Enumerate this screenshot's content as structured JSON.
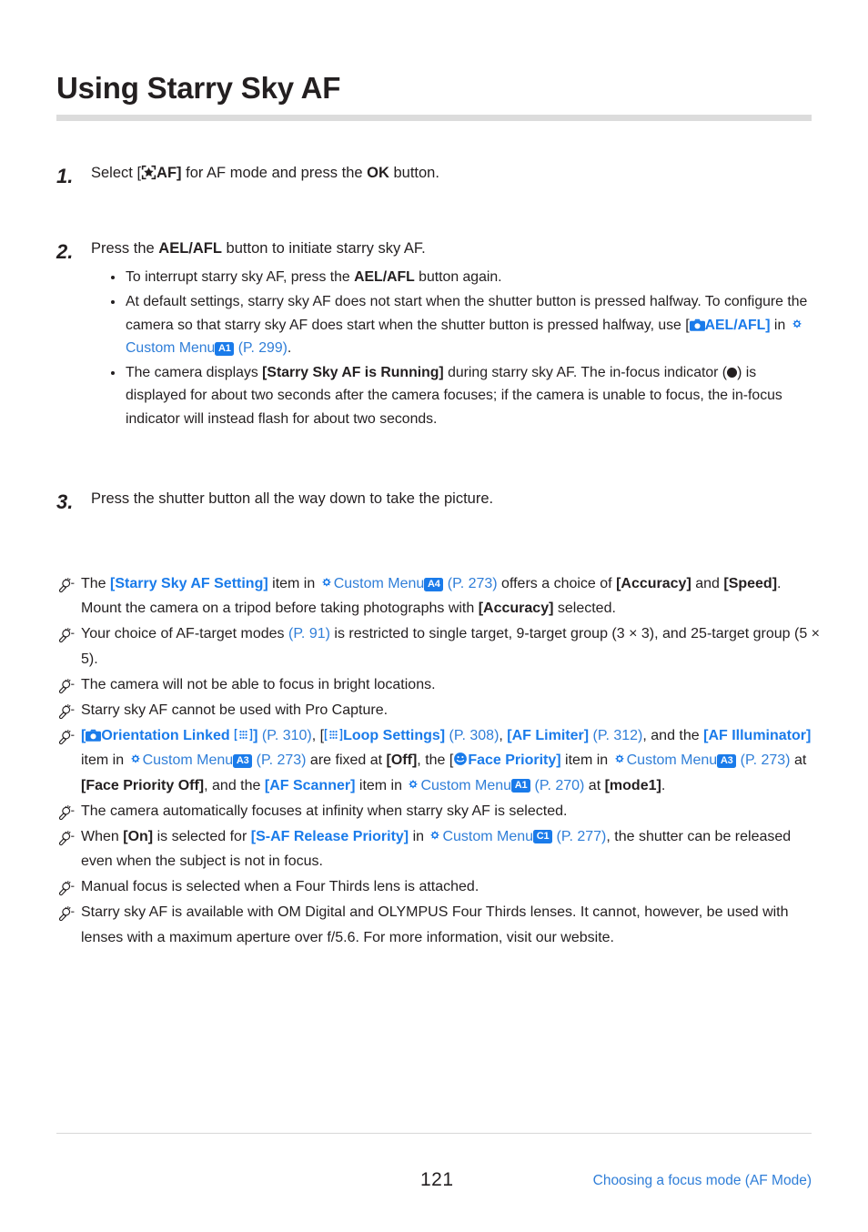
{
  "page": {
    "title": "Using Starry Sky AF",
    "folio": "121",
    "footer_link": "Choosing a focus mode (AF Mode)"
  },
  "colors": {
    "link_blue": "#2f7ed8",
    "bold_link_blue": "#1a7bea",
    "badge_blue": "#1a7bea",
    "text": "#231f20",
    "rule_gray": "#dcdcdc"
  },
  "steps": [
    {
      "number": "1.",
      "text_parts": {
        "p1": "Select [",
        "icon": "starry-sky-af-icon",
        "p2": "AF]",
        "p3": " for AF mode and press the ",
        "bold": "OK",
        "p4": " button."
      }
    },
    {
      "number": "2.",
      "text_parts": {
        "p1": "Press the ",
        "bold": "AEL/AFL",
        "p2": " button to initiate starry sky AF."
      },
      "bullets": [
        {
          "p1": "To interrupt starry sky AF, press the ",
          "bold": "AEL/AFL",
          "p2": " button again."
        },
        {
          "p1": "At default settings, starry sky AF does not start when the shutter button is pressed halfway. To configure the camera so that starry sky AF does start when the shutter button is pressed halfway, use [",
          "icon": "camera-icon",
          "link_bold": "AEL/AFL]",
          "p2": " in ",
          "gear": "gear-icon",
          "link": "Custom Menu",
          "badge": "A1",
          "page_ref": "(P. 299)",
          "p3": "."
        },
        {
          "p1": "The camera displays ",
          "bold": "[Starry Sky AF is Running]",
          "p2": " during starry sky AF. The in-focus indicator (",
          "dot": "in-focus-indicator-dot",
          "p3": ") is displayed for about two seconds after the camera focuses; if the camera is unable to focus, the in-focus indicator will instead flash for about two seconds."
        }
      ]
    },
    {
      "number": "3.",
      "text_parts": {
        "p1": "Press the shutter button all the way down to take the picture."
      }
    }
  ],
  "notes": [
    {
      "id": "note-starry-sky-af-setting",
      "p1": "The ",
      "link_bold": "[Starry Sky AF Setting]",
      "p2": " item in ",
      "gear": "gear-icon",
      "link": "Custom Menu",
      "badge": "A4",
      "page_ref": "(P. 273)",
      "p3": " offers a choice of ",
      "bold1": "[Accuracy]",
      "p4": " and ",
      "bold2": "[Speed]",
      "p5": ". Mount the camera on a tripod before taking photographs with ",
      "bold3": "[Accuracy]",
      "p6": " selected."
    },
    {
      "id": "note-af-target-modes",
      "p1": "Your choice of AF-target modes ",
      "page_ref": "(P. 91)",
      "p2": " is restricted to single target, 9-target group (3 × 3), and 25-target group (5 × 5)."
    },
    {
      "id": "note-bright-locations",
      "p1": "The camera will not be able to focus in bright locations."
    },
    {
      "id": "note-pro-capture",
      "p1": "Starry sky AF cannot be used with Pro Capture."
    },
    {
      "id": "note-fixed-settings",
      "p1": "[",
      "camera_icon": "camera-icon",
      "link_bold1": "Orientation Linked",
      "target_icon1": "af-target-grid-icon",
      "link_bold1_close": "]",
      "page_ref1": "(P. 310)",
      "p2": ", [",
      "target_icon2": "af-target-grid-icon",
      "link_bold2": "Loop Settings]",
      "page_ref2": "(P. 308)",
      "p3": ", ",
      "link_bold3": "[AF Limiter]",
      "page_ref3": "(P. 312)",
      "p4": ", and the ",
      "link_bold4": "[AF Illuminator]",
      "p5": " item in ",
      "gear1": "gear-icon",
      "link1": "Custom Menu",
      "badge1": "A3",
      "page_ref4": "(P. 273)",
      "p6": " are fixed at ",
      "bold1": "[Off]",
      "p7": ", the [",
      "face_icon": "face-priority-icon",
      "link_bold5": "Face Priority]",
      "p8": " item in ",
      "gear2": "gear-icon",
      "link2": "Custom Menu",
      "badge2": "A3",
      "page_ref5": "(P. 273)",
      "p9": " at ",
      "bold2": "[Face Priority Off]",
      "p10": ", and the ",
      "link_bold6": "[AF Scanner]",
      "p11": " item in ",
      "gear3": "gear-icon",
      "link3": "Custom Menu",
      "badge3": "A1",
      "page_ref6": "(P. 270)",
      "p12": " at ",
      "bold3": "[mode1]",
      "p13": "."
    },
    {
      "id": "note-infinity-focus",
      "p1": "The camera automatically focuses at infinity when starry sky AF is selected."
    },
    {
      "id": "note-s-af-release-priority",
      "p1": "When ",
      "bold1": "[On]",
      "p2": " is selected for ",
      "link_bold": "[S-AF Release Priority]",
      "p3": " in ",
      "gear": "gear-icon",
      "link": "Custom Menu",
      "badge": "C1",
      "page_ref": "(P. 277)",
      "p4": ", the shutter can be released even when the subject is not in focus."
    },
    {
      "id": "note-four-thirds-manual-focus",
      "p1": "Manual focus is selected when a Four Thirds lens is attached."
    },
    {
      "id": "note-lens-compatibility",
      "p1": "Starry sky AF is available with OM Digital and OLYMPUS Four Thirds lenses. It cannot, however, be used with lenses with a maximum aperture over f/5.6. For more information, visit our website."
    }
  ]
}
